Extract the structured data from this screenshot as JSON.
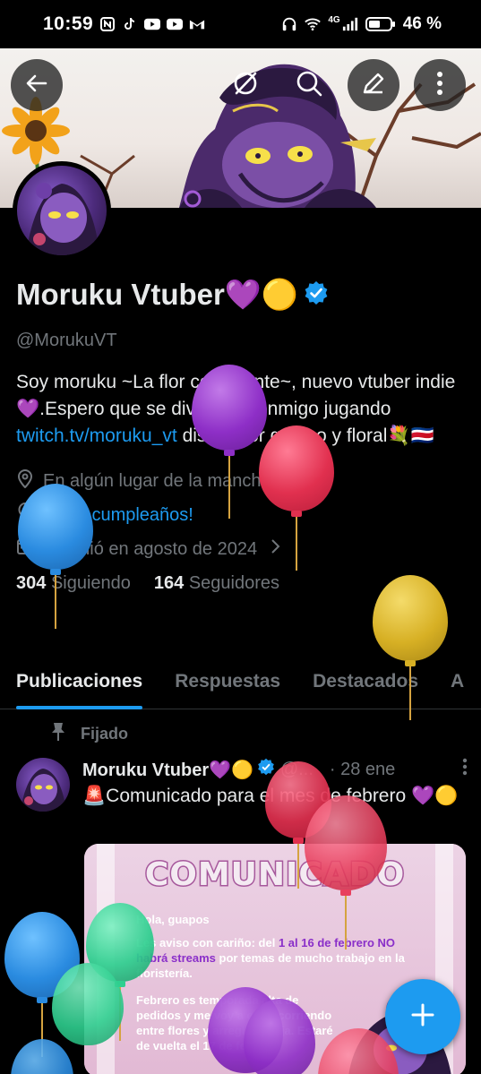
{
  "status_bar": {
    "time": "10:59",
    "network": "4G",
    "battery": "46 %"
  },
  "profile": {
    "display_name": "Moruku Vtuber💜🟡",
    "handle": "@MorukuVT",
    "bio_part1": "Soy moruku ~La flor consciente~, nuevo vtuber indie💜.Espero que se diviertan conmigo jugando ",
    "bio_link": "twitch.tv/moruku_vt",
    "bio_part2": " diseñador gráfico y floral💐🇨🇷",
    "location": "En algún lugar de la mancha",
    "birthday": "¡Feliz cumpleaños!",
    "joined": "Se unió en agosto de 2024",
    "following_count": "304",
    "following_label": "Siguiendo",
    "followers_count": "164",
    "followers_label": "Seguidores"
  },
  "tabs": [
    {
      "label": "Publicaciones"
    },
    {
      "label": "Respuestas"
    },
    {
      "label": "Destacados"
    },
    {
      "label": "A"
    }
  ],
  "post": {
    "pinned_label": "Fijado",
    "author": "Moruku Vtuber💜🟡",
    "handle_trunc": "@...",
    "date": "· 28 ene",
    "text": "🚨Comunicado para el mes de febrero 💜🟡",
    "media": {
      "title": "COMUNICADO",
      "greeting": "Hola, guapos",
      "line1_a": "Les aviso con cariño: del ",
      "line1_hl": "1 al 16 de febrero NO habrá streams",
      "line1_b": " por temas de mucho trabajo en la floristería.",
      "line2": "Febrero es temporada alta de pedidos y me voy a estar corriendo entre flores y arreglos jajaja. Estaré de vuelta el 17 de febrero"
    }
  },
  "icons": {
    "back": "arrow-left-icon",
    "grok": "grok-icon",
    "search": "search-icon",
    "edit": "edit-icon",
    "more": "more-vertical-icon",
    "verified": "verified-badge-icon",
    "location": "location-pin-icon",
    "birthday": "balloon-icon",
    "calendar": "calendar-icon",
    "chevron": "chevron-right-icon",
    "pin": "pin-icon",
    "compose": "plus-icon"
  },
  "colors": {
    "accent": "#1d9bf0",
    "background": "#000000",
    "text_primary": "#e7e9ea",
    "text_secondary": "#71767b"
  }
}
